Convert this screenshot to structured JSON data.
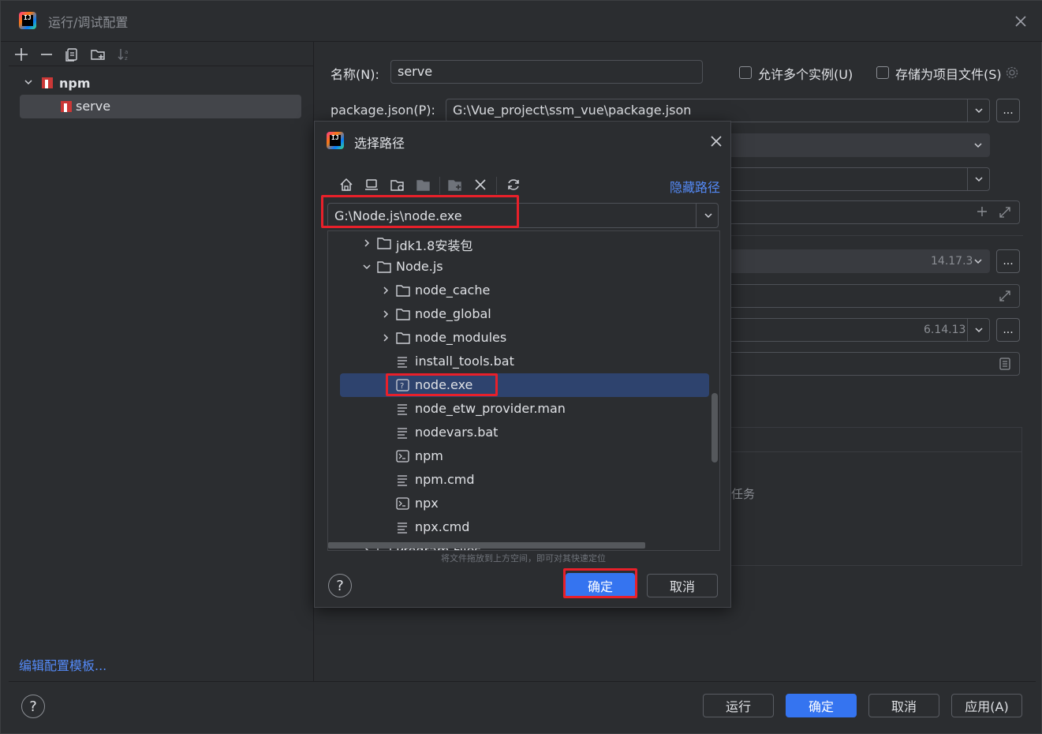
{
  "window": {
    "title": "运行/调试配置"
  },
  "left_panel": {
    "tree": {
      "group_label": "npm",
      "selected_item": "serve"
    },
    "edit_templates_link": "编辑配置模板..."
  },
  "form": {
    "name_label": "名称(N):",
    "name_value": "serve",
    "allow_multiple_label": "允许多个实例(U)",
    "store_as_file_label": "存储为项目文件(S)",
    "package_json_label": "package.json(P):",
    "package_json_value": "G:\\Vue_project\\ssm_vue\\package.json",
    "node_version": "14.17.3",
    "npm_version": "6.14.13",
    "browse_label": "...",
    "partial_task_text": "任务"
  },
  "dialog": {
    "title": "选择路径",
    "hide_path_link": "隐藏路径",
    "path_value": "G:\\Node.js\\node.exe",
    "tree": [
      {
        "label": "jdk1.8安装包",
        "type": "folder",
        "expanded": false,
        "level": 1
      },
      {
        "label": "Node.js",
        "type": "folder",
        "expanded": true,
        "level": 1
      },
      {
        "label": "node_cache",
        "type": "folder",
        "expanded": false,
        "level": 2
      },
      {
        "label": "node_global",
        "type": "folder",
        "expanded": false,
        "level": 2
      },
      {
        "label": "node_modules",
        "type": "folder",
        "expanded": false,
        "level": 2
      },
      {
        "label": "install_tools.bat",
        "type": "text-file",
        "level": 2
      },
      {
        "label": "node.exe",
        "type": "unknown-file",
        "level": 2,
        "selected": true
      },
      {
        "label": "node_etw_provider.man",
        "type": "text-file",
        "level": 2
      },
      {
        "label": "nodevars.bat",
        "type": "text-file",
        "level": 2
      },
      {
        "label": "npm",
        "type": "script-file",
        "level": 2
      },
      {
        "label": "npm.cmd",
        "type": "text-file",
        "level": 2
      },
      {
        "label": "npx",
        "type": "script-file",
        "level": 2
      },
      {
        "label": "npx.cmd",
        "type": "text-file",
        "level": 2
      },
      {
        "label": "Program Files",
        "type": "folder",
        "expanded": false,
        "level": 1
      }
    ],
    "hint": "将文件拖放到上方空间，即可对其快速定位",
    "ok_label": "确定",
    "cancel_label": "取消"
  },
  "bottom_buttons": {
    "run": "运行",
    "ok": "确定",
    "cancel": "取消",
    "apply": "应用(A)"
  },
  "colors": {
    "accent": "#3574f0",
    "highlight_red": "#e8202a",
    "selection": "#2e436e",
    "link": "#548af7"
  }
}
